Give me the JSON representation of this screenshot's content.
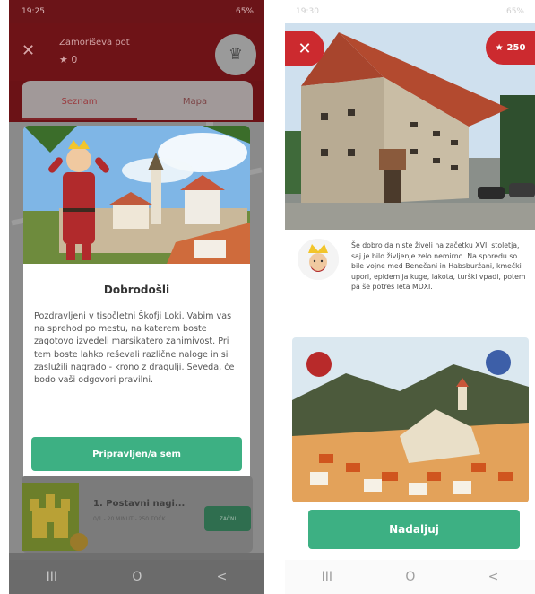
{
  "left": {
    "status": {
      "time": "19:25",
      "battery": "65%"
    },
    "header": {
      "title": "Zamoriševa pot",
      "stars": "0"
    },
    "tabs": [
      {
        "label": "Seznam"
      },
      {
        "label": "Mapa"
      }
    ],
    "modal": {
      "title": "Dobrodošli",
      "body": "Pozdravljeni v tisočletni Škofji Loki. Vabim vas na sprehod po mestu, na katerem boste zagotovo izvedeli marsikatero zanimivost. Pri tem boste lahko reševali različne naloge in si zaslužili nagrado - krono z dragulji. Seveda, če bodo vaši odgovori pravilni.",
      "button": "Pripravljen/a sem"
    },
    "task": {
      "title": "1. Postavni nagi...",
      "subtitle": "0/1 - 20 MINUT - 250 TOČK",
      "button": "ZAČNI"
    },
    "nav": {
      "recent": "III",
      "home": "O",
      "back": "<"
    }
  },
  "right": {
    "status": {
      "time": "19:30",
      "battery": "65%"
    },
    "points": "250",
    "close_icon": "close-icon",
    "story": "Še dobro da niste živeli na začetku XVI. stoletja, saj je bilo življenje zelo nemirno. Na sporedu so bile vojne med Benečani in Habsburžani, kmečki upori, epidemija kuge, lakota, turški vpadi, potem pa še potres leta MDXI.",
    "button": "Nadaljuj",
    "nav": {
      "recent": "III",
      "home": "O",
      "back": "<"
    }
  },
  "colors": {
    "brand_red": "#6e1317",
    "accent_red": "#cc2a2f",
    "green": "#3db083"
  }
}
